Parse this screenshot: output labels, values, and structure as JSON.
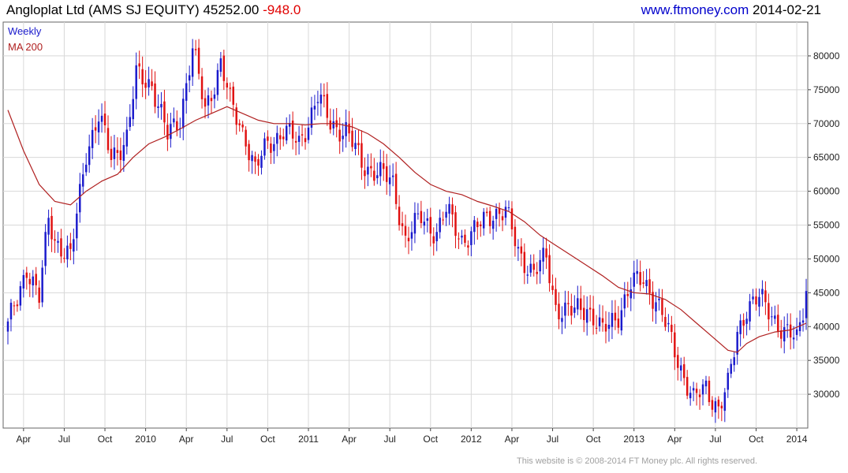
{
  "header": {
    "title": "Angloplat Ltd (AMS SJ EQUITY)",
    "price": "45252.00",
    "change": "-948.0",
    "site": "www.ftmoney.com",
    "date": "2014-02-21"
  },
  "footer": {
    "copyright": "This website is © 2008-2014 FT Money plc. All rights reserved."
  },
  "colors": {
    "up": "#1a1acc",
    "down": "#e01010",
    "ma": "#b02020",
    "grid": "#d8d8d8"
  },
  "chart_data": {
    "type": "candlestick",
    "title": "Angloplat Ltd (AMS SJ EQUITY)",
    "legend": [
      "Weekly",
      "MA 200"
    ],
    "legend_position": "top-left",
    "grid": true,
    "ylim": [
      25000,
      85000
    ],
    "y_ticks": [
      30000,
      35000,
      40000,
      45000,
      50000,
      55000,
      60000,
      65000,
      70000,
      75000,
      80000
    ],
    "x_ticks": [
      {
        "label": "Apr",
        "x": 5
      },
      {
        "label": "Jul",
        "x": 18
      },
      {
        "label": "Oct",
        "x": 31
      },
      {
        "label": "2010",
        "x": 44
      },
      {
        "label": "Apr",
        "x": 57
      },
      {
        "label": "Jul",
        "x": 70
      },
      {
        "label": "Oct",
        "x": 83
      },
      {
        "label": "2011",
        "x": 96
      },
      {
        "label": "Apr",
        "x": 109
      },
      {
        "label": "Jul",
        "x": 122
      },
      {
        "label": "Oct",
        "x": 135
      },
      {
        "label": "2012",
        "x": 148
      },
      {
        "label": "Apr",
        "x": 161
      },
      {
        "label": "Jul",
        "x": 174
      },
      {
        "label": "Oct",
        "x": 187
      },
      {
        "label": "2013",
        "x": 200
      },
      {
        "label": "Apr",
        "x": 213
      },
      {
        "label": "Jul",
        "x": 226
      },
      {
        "label": "Oct",
        "x": 239
      },
      {
        "label": "2014",
        "x": 252
      }
    ],
    "weeks": 256,
    "anchors": [
      {
        "x": 0,
        "close": 40000
      },
      {
        "x": 3,
        "close": 44000
      },
      {
        "x": 6,
        "close": 49000
      },
      {
        "x": 10,
        "close": 44000
      },
      {
        "x": 13,
        "close": 56000
      },
      {
        "x": 15,
        "close": 53000
      },
      {
        "x": 20,
        "close": 50000
      },
      {
        "x": 25,
        "close": 66000
      },
      {
        "x": 29,
        "close": 71000
      },
      {
        "x": 33,
        "close": 65000
      },
      {
        "x": 38,
        "close": 68000
      },
      {
        "x": 41,
        "close": 77000
      },
      {
        "x": 46,
        "close": 76000
      },
      {
        "x": 51,
        "close": 68000
      },
      {
        "x": 55,
        "close": 71000
      },
      {
        "x": 59,
        "close": 81000
      },
      {
        "x": 63,
        "close": 72000
      },
      {
        "x": 68,
        "close": 79000
      },
      {
        "x": 71,
        "close": 73000
      },
      {
        "x": 76,
        "close": 68000
      },
      {
        "x": 79,
        "close": 63000
      },
      {
        "x": 83,
        "close": 67000
      },
      {
        "x": 88,
        "close": 69000
      },
      {
        "x": 93,
        "close": 67000
      },
      {
        "x": 99,
        "close": 74000
      },
      {
        "x": 103,
        "close": 70000
      },
      {
        "x": 108,
        "close": 69000
      },
      {
        "x": 113,
        "close": 64000
      },
      {
        "x": 118,
        "close": 63000
      },
      {
        "x": 123,
        "close": 61000
      },
      {
        "x": 127,
        "close": 53000
      },
      {
        "x": 132,
        "close": 56000
      },
      {
        "x": 137,
        "close": 54000
      },
      {
        "x": 140,
        "close": 57000
      },
      {
        "x": 145,
        "close": 53000
      },
      {
        "x": 149,
        "close": 54000
      },
      {
        "x": 155,
        "close": 57000
      },
      {
        "x": 159,
        "close": 57000
      },
      {
        "x": 163,
        "close": 51000
      },
      {
        "x": 168,
        "close": 48000
      },
      {
        "x": 172,
        "close": 50000
      },
      {
        "x": 175,
        "close": 43000
      },
      {
        "x": 180,
        "close": 42000
      },
      {
        "x": 185,
        "close": 43000
      },
      {
        "x": 190,
        "close": 39000
      },
      {
        "x": 195,
        "close": 42000
      },
      {
        "x": 199,
        "close": 46000
      },
      {
        "x": 203,
        "close": 47000
      },
      {
        "x": 207,
        "close": 44000
      },
      {
        "x": 211,
        "close": 39000
      },
      {
        "x": 215,
        "close": 34000
      },
      {
        "x": 219,
        "close": 29000
      },
      {
        "x": 223,
        "close": 31000
      },
      {
        "x": 227,
        "close": 28000
      },
      {
        "x": 230,
        "close": 31000
      },
      {
        "x": 233,
        "close": 39000
      },
      {
        "x": 236,
        "close": 43000
      },
      {
        "x": 240,
        "close": 44000
      },
      {
        "x": 244,
        "close": 42000
      },
      {
        "x": 248,
        "close": 39000
      },
      {
        "x": 252,
        "close": 38000
      },
      {
        "x": 255,
        "close": 45252
      }
    ],
    "ma200": [
      {
        "x": 0,
        "y": 72000
      },
      {
        "x": 5,
        "y": 66000
      },
      {
        "x": 10,
        "y": 61000
      },
      {
        "x": 15,
        "y": 58500
      },
      {
        "x": 20,
        "y": 58000
      },
      {
        "x": 25,
        "y": 60000
      },
      {
        "x": 30,
        "y": 61500
      },
      {
        "x": 35,
        "y": 62500
      },
      {
        "x": 40,
        "y": 65000
      },
      {
        "x": 45,
        "y": 67000
      },
      {
        "x": 50,
        "y": 68000
      },
      {
        "x": 55,
        "y": 69200
      },
      {
        "x": 60,
        "y": 70500
      },
      {
        "x": 65,
        "y": 71500
      },
      {
        "x": 70,
        "y": 72500
      },
      {
        "x": 75,
        "y": 71500
      },
      {
        "x": 80,
        "y": 70500
      },
      {
        "x": 85,
        "y": 70000
      },
      {
        "x": 90,
        "y": 70000
      },
      {
        "x": 95,
        "y": 69800
      },
      {
        "x": 100,
        "y": 70000
      },
      {
        "x": 105,
        "y": 70000
      },
      {
        "x": 110,
        "y": 69500
      },
      {
        "x": 115,
        "y": 68500
      },
      {
        "x": 120,
        "y": 67000
      },
      {
        "x": 125,
        "y": 65000
      },
      {
        "x": 130,
        "y": 62800
      },
      {
        "x": 135,
        "y": 61000
      },
      {
        "x": 140,
        "y": 60000
      },
      {
        "x": 145,
        "y": 59500
      },
      {
        "x": 150,
        "y": 58500
      },
      {
        "x": 155,
        "y": 57800
      },
      {
        "x": 160,
        "y": 57000
      },
      {
        "x": 165,
        "y": 55500
      },
      {
        "x": 170,
        "y": 53500
      },
      {
        "x": 175,
        "y": 52000
      },
      {
        "x": 180,
        "y": 50500
      },
      {
        "x": 185,
        "y": 49000
      },
      {
        "x": 190,
        "y": 47500
      },
      {
        "x": 195,
        "y": 45800
      },
      {
        "x": 200,
        "y": 45000
      },
      {
        "x": 205,
        "y": 44800
      },
      {
        "x": 210,
        "y": 44000
      },
      {
        "x": 215,
        "y": 42500
      },
      {
        "x": 220,
        "y": 40500
      },
      {
        "x": 225,
        "y": 38500
      },
      {
        "x": 230,
        "y": 36500
      },
      {
        "x": 233,
        "y": 36200
      },
      {
        "x": 236,
        "y": 37500
      },
      {
        "x": 240,
        "y": 38500
      },
      {
        "x": 245,
        "y": 39200
      },
      {
        "x": 250,
        "y": 39500
      },
      {
        "x": 255,
        "y": 40500
      }
    ]
  }
}
